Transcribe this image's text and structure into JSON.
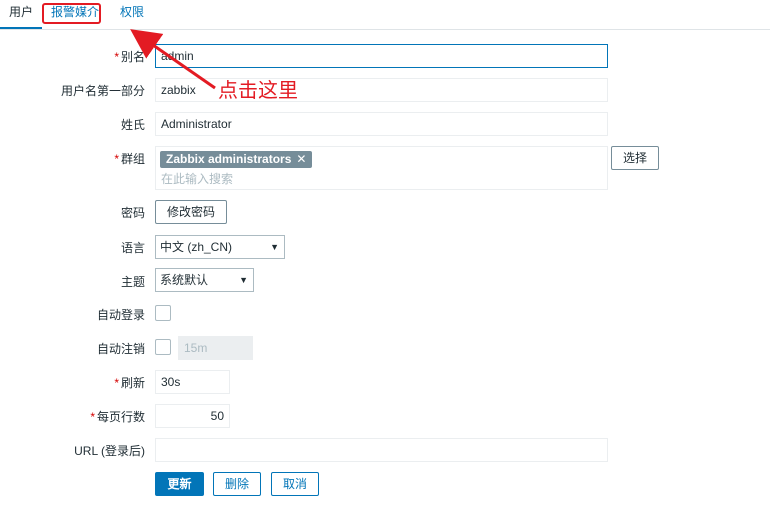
{
  "tabs": [
    {
      "label": "用户",
      "active": true
    },
    {
      "label": "报警媒介",
      "active": false
    },
    {
      "label": "权限",
      "active": false
    }
  ],
  "annotation": {
    "text": "点击这里",
    "color": "#e31b23"
  },
  "form": {
    "alias": {
      "label": "别名",
      "required": true,
      "value": "admin"
    },
    "name": {
      "label": "用户名第一部分",
      "value": "zabbix"
    },
    "surname": {
      "label": "姓氏",
      "value": "Administrator"
    },
    "groups": {
      "label": "群组",
      "required": true,
      "chip": "Zabbix administrators",
      "placeholder": "在此输入搜索",
      "select_button": "选择"
    },
    "password": {
      "label": "密码",
      "button": "修改密码"
    },
    "language": {
      "label": "语言",
      "value": "中文 (zh_CN)"
    },
    "theme": {
      "label": "主题",
      "value": "系统默认"
    },
    "autologin": {
      "label": "自动登录",
      "checked": false
    },
    "autologout": {
      "label": "自动注销",
      "checked": false,
      "value": "15m"
    },
    "refresh": {
      "label": "刷新",
      "required": true,
      "value": "30s"
    },
    "rows_per_page": {
      "label": "每页行数",
      "required": true,
      "value": "50"
    },
    "url": {
      "label": "URL (登录后)",
      "value": ""
    }
  },
  "actions": {
    "update": "更新",
    "delete": "删除",
    "cancel": "取消"
  },
  "colors": {
    "accent": "#0275b8",
    "annotation": "#e31b23",
    "chip": "#768d99"
  }
}
